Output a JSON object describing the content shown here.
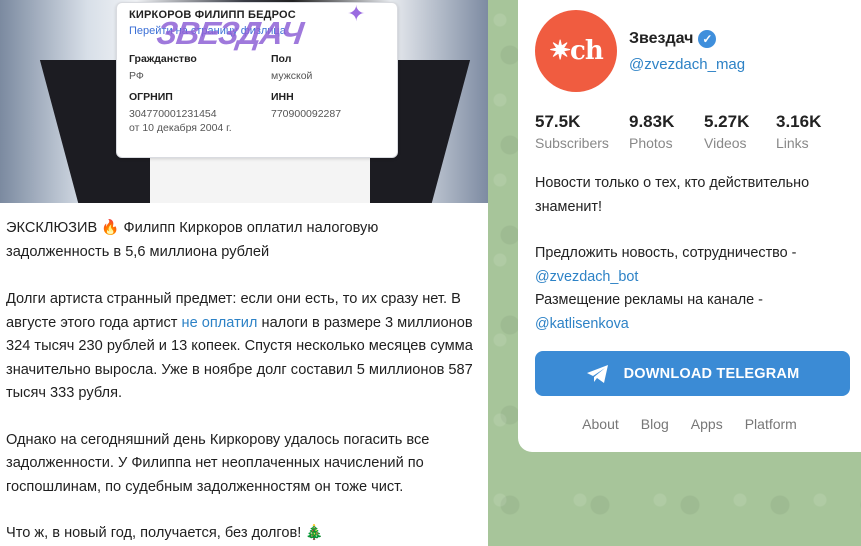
{
  "post": {
    "doc": {
      "name": "КИРКОРОВ ФИЛИПП БЕДРОС",
      "link": "Перейти на страницу физлица",
      "stamp": "ЗВЕЗДАЧ",
      "citizenship_label": "Гражданство",
      "citizenship_value": "РФ",
      "sex_label": "Пол",
      "sex_value": "мужской",
      "ogrnip_label": "ОГРНИП",
      "ogrnip_value": "304770001231454",
      "ogrnip_date": "от 10 декабря 2004 г.",
      "inn_label": "ИНН",
      "inn_value": "770900092287"
    },
    "headline_prefix": "ЭКСКЛЮЗИВ",
    "headline_text": "Филипп Киркоров оплатил налоговую задолженность в 5,6 миллиона рублей",
    "p1_a": "Долги артиста странный предмет: если они есть, то их сразу нет. В августе этого года артист ",
    "p1_link": "не оплатил",
    "p1_b": " налоги в размере 3 миллионов 324 тысяч 230 рублей и 13 копеек. Спустя несколько месяцев сумма значительно выросла. Уже в ноябре долг составил 5 миллионов 587 тысяч 333 рубля.",
    "p2": "Однако на сегодняшний день Киркорову удалось погасить все задолженности. У Филиппа нет неоплаченных начислений по госпошлинам, по судебным задолженностям он тоже чист.",
    "p3": "Что ж, в новый год, получается, без долгов!"
  },
  "channel": {
    "name": "Звездач",
    "handle": "@zvezdach_mag",
    "avatar_text": "✷ch",
    "stats": [
      {
        "num": "57.5K",
        "label": "Subscribers"
      },
      {
        "num": "9.83K",
        "label": "Photos"
      },
      {
        "num": "5.27K",
        "label": "Videos"
      },
      {
        "num": "3.16K",
        "label": "Links"
      }
    ],
    "desc1": "Новости только о тех, кто действительно знаменит!",
    "desc2": "Предложить новость, сотрудничество - ",
    "desc2_link": "@zvezdach_bot",
    "desc3": "Размещение рекламы на канале - ",
    "desc3_link": "@katlisenkova",
    "download_label": "DOWNLOAD TELEGRAM",
    "footer": [
      "About",
      "Blog",
      "Apps",
      "Platform"
    ]
  },
  "colors": {
    "accent": "#3b8bd5",
    "avatar": "#f05c40",
    "link": "#2d82c6"
  }
}
